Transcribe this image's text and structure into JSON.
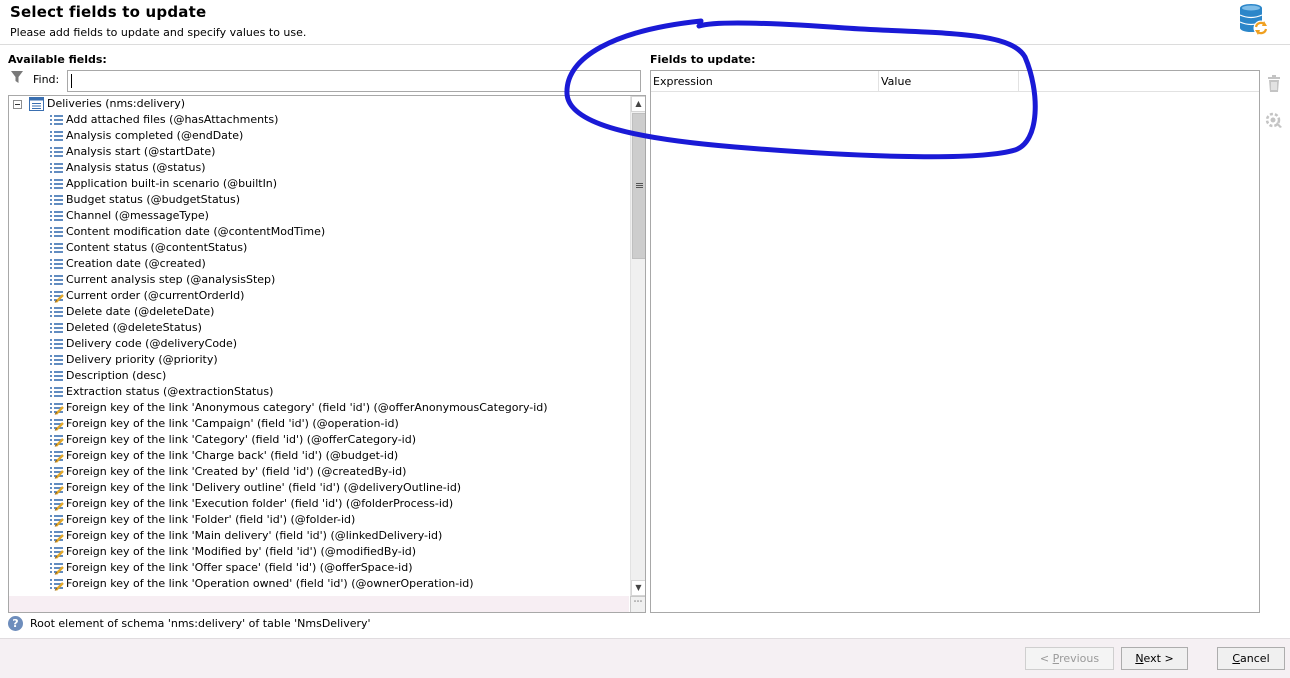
{
  "header": {
    "title": "Select fields to update",
    "subtitle": "Please add fields to update and specify values to use."
  },
  "available": {
    "label": "Available fields:",
    "find_label": "Find:",
    "find_value": "",
    "tree": {
      "root": "Deliveries (nms:delivery)",
      "items": [
        {
          "label": "Add attached files (@hasAttachments)",
          "icon": "field-icon"
        },
        {
          "label": "Analysis completed (@endDate)",
          "icon": "field-icon"
        },
        {
          "label": "Analysis start (@startDate)",
          "icon": "field-icon"
        },
        {
          "label": "Analysis status (@status)",
          "icon": "field-icon"
        },
        {
          "label": "Application built-in scenario (@builtIn)",
          "icon": "field-icon"
        },
        {
          "label": "Budget status (@budgetStatus)",
          "icon": "field-icon"
        },
        {
          "label": "Channel (@messageType)",
          "icon": "field-icon"
        },
        {
          "label": "Content modification date (@contentModTime)",
          "icon": "field-icon"
        },
        {
          "label": "Content status (@contentStatus)",
          "icon": "field-icon"
        },
        {
          "label": "Creation date (@created)",
          "icon": "field-icon"
        },
        {
          "label": "Current analysis step (@analysisStep)",
          "icon": "field-icon"
        },
        {
          "label": "Current order (@currentOrderId)",
          "icon": "key-field-icon"
        },
        {
          "label": "Delete date (@deleteDate)",
          "icon": "field-icon"
        },
        {
          "label": "Deleted (@deleteStatus)",
          "icon": "field-icon"
        },
        {
          "label": "Delivery code (@deliveryCode)",
          "icon": "field-icon"
        },
        {
          "label": "Delivery priority (@priority)",
          "icon": "field-icon"
        },
        {
          "label": "Description (desc)",
          "icon": "field-icon"
        },
        {
          "label": "Extraction status (@extractionStatus)",
          "icon": "field-icon"
        },
        {
          "label": "Foreign key of the link 'Anonymous category' (field 'id') (@offerAnonymousCategory-id)",
          "icon": "key-field-icon"
        },
        {
          "label": "Foreign key of the link 'Campaign' (field 'id') (@operation-id)",
          "icon": "key-field-icon"
        },
        {
          "label": "Foreign key of the link 'Category' (field 'id') (@offerCategory-id)",
          "icon": "key-field-icon"
        },
        {
          "label": "Foreign key of the link 'Charge back' (field 'id') (@budget-id)",
          "icon": "key-field-icon"
        },
        {
          "label": "Foreign key of the link 'Created by' (field 'id') (@createdBy-id)",
          "icon": "key-field-icon"
        },
        {
          "label": "Foreign key of the link 'Delivery outline' (field 'id') (@deliveryOutline-id)",
          "icon": "key-field-icon"
        },
        {
          "label": "Foreign key of the link 'Execution folder' (field 'id') (@folderProcess-id)",
          "icon": "key-field-icon"
        },
        {
          "label": "Foreign key of the link 'Folder' (field 'id') (@folder-id)",
          "icon": "key-field-icon"
        },
        {
          "label": "Foreign key of the link 'Main delivery' (field 'id') (@linkedDelivery-id)",
          "icon": "key-field-icon"
        },
        {
          "label": "Foreign key of the link 'Modified by' (field 'id') (@modifiedBy-id)",
          "icon": "key-field-icon"
        },
        {
          "label": "Foreign key of the link 'Offer space' (field 'id') (@offerSpace-id)",
          "icon": "key-field-icon"
        },
        {
          "label": "Foreign key of the link 'Operation owned' (field 'id') (@ownerOperation-id)",
          "icon": "key-field-icon"
        }
      ]
    },
    "scrollbar": {
      "grip_glyph": "≡",
      "corner_glyph": "⋯"
    }
  },
  "fields": {
    "label": "Fields to update:",
    "columns": [
      "Expression",
      "Value"
    ]
  },
  "status": {
    "help_glyph": "?",
    "text": "Root element of schema 'nms:delivery' of table 'NmsDelivery'"
  },
  "footer": {
    "previous": {
      "lead": "< ",
      "accel": "P",
      "rest": "revious"
    },
    "next": {
      "accel": "N",
      "rest": "ext >"
    },
    "cancel": {
      "accel": "C",
      "rest": "ancel"
    }
  },
  "colors": {
    "annotation": "#1a1ad6",
    "db_icon": "#2b86c9",
    "db_icon_accent": "#f0a020",
    "field_icon": "#3a6fb0",
    "key_icon": "#e2a82a"
  }
}
